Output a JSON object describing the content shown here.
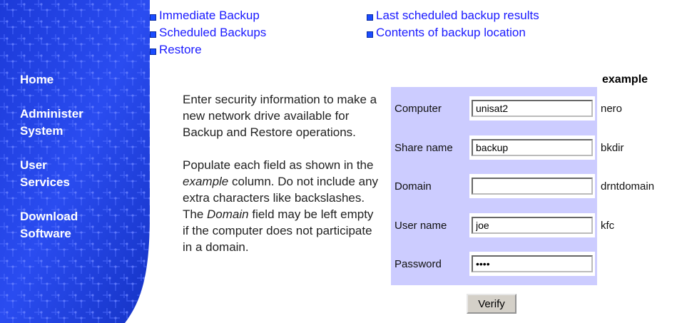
{
  "sidebar": {
    "items": [
      {
        "label": "Home"
      },
      {
        "label": "Administer\nSystem"
      },
      {
        "label": "User\nServices"
      },
      {
        "label": "Download\nSoftware"
      }
    ]
  },
  "top_links": {
    "col1": [
      "Immediate Backup",
      "Scheduled Backups",
      "Restore"
    ],
    "col2": [
      "Last scheduled backup results",
      "Contents of backup location"
    ]
  },
  "instructions": {
    "p1": "Enter security information to make a new network drive available for Backup and Restore operations.",
    "p2_a": "Populate each field as shown in the ",
    "p2_example": "example",
    "p2_b": " column. Do not include any extra characters like backslashes. The ",
    "p2_domain": "Domain",
    "p2_c": " field may be left empty if the computer does not participate in a domain."
  },
  "form": {
    "example_header": "example",
    "rows": [
      {
        "label": "Computer",
        "value": "unisat2",
        "example": "nero"
      },
      {
        "label": "Share name",
        "value": "backup",
        "example": "bkdir"
      },
      {
        "label": "Domain",
        "value": "",
        "example": "drntdomain"
      },
      {
        "label": "User name",
        "value": "joe",
        "example": "kfc"
      },
      {
        "label": "Password",
        "value": "****",
        "example": ""
      }
    ],
    "verify_label": "Verify"
  },
  "colors": {
    "sidebar_blue": "#1f3fe0",
    "link_blue": "#1a1aff",
    "form_bg": "#ccccff"
  }
}
